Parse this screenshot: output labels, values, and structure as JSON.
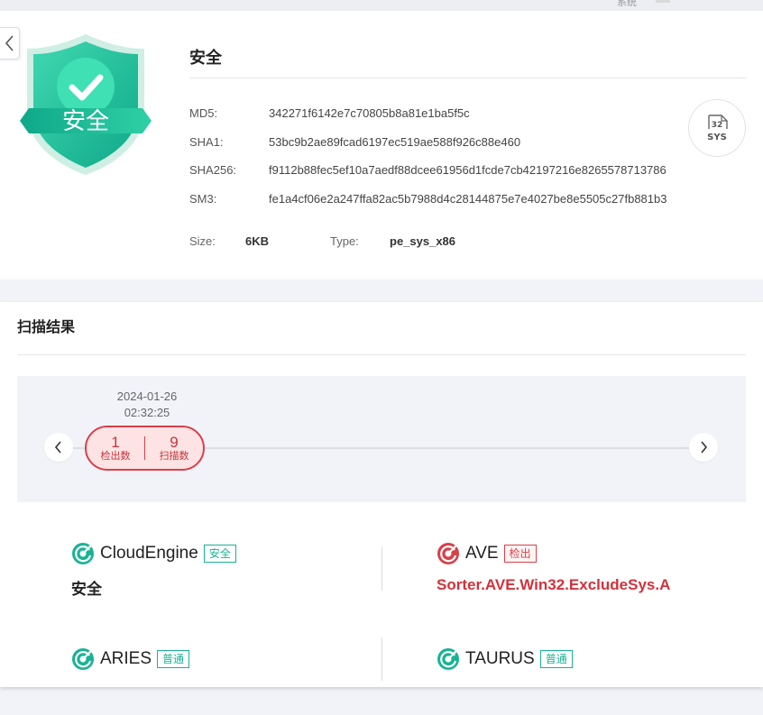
{
  "top_hint": "系统",
  "file": {
    "shield_label": "安全",
    "title": "安全",
    "hashes": [
      {
        "key": "MD5:",
        "value": "342271f6142e7c70805b8a81e1ba5f5c"
      },
      {
        "key": "SHA1:",
        "value": "53bc9b2ae89fcad6197ec519ae588f926c88e460"
      },
      {
        "key": "SHA256:",
        "value": "f9112b88fec5ef10a7aedf88dcee61956d1fcde7cb42197216e8265578713786"
      },
      {
        "key": "SM3:",
        "value": "fe1a4cf06e2a247ffa82ac5b7988d4c28144875e7e4027be8e5505c27fb881b3"
      }
    ],
    "size_label": "Size:",
    "size_value": "6KB",
    "type_label": "Type:",
    "type_value": "pe_sys_x86",
    "sys_badge_top": "32",
    "sys_badge_bottom": "SYS"
  },
  "scan": {
    "title": "扫描结果",
    "timeline": {
      "date": "2024-01-26",
      "time": "02:32:25",
      "detected_count": "1",
      "detected_label": "检出数",
      "scanned_count": "9",
      "scanned_label": "扫描数"
    },
    "engines": [
      {
        "name": "CloudEngine",
        "tag": "安全",
        "result": "安全",
        "status": "safe"
      },
      {
        "name": "AVE",
        "tag": "检出",
        "result": "Sorter.AVE.Win32.ExcludeSys.A",
        "status": "detected"
      },
      {
        "name": "ARIES",
        "tag": "普通",
        "result": "",
        "status": "normal"
      },
      {
        "name": "TAURUS",
        "tag": "普通",
        "result": "",
        "status": "normal"
      }
    ]
  },
  "colors": {
    "safe_green": "#19b394",
    "danger_red": "#d8404a",
    "timeline_bg": "#f1f3f9"
  }
}
